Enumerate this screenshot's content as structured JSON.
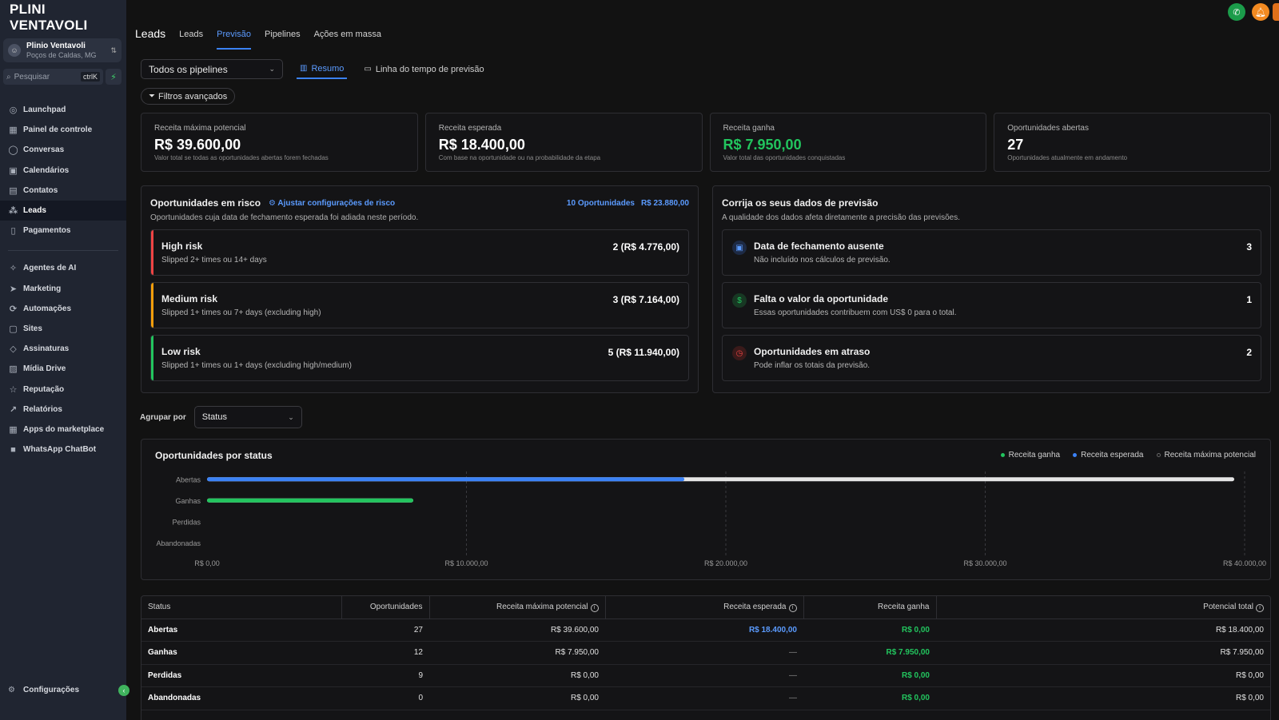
{
  "sidebar": {
    "logo": "PLINI VENTAVOLI",
    "account": {
      "name": "Plinio Ventavoli",
      "location": "Poços de Caldas, MG"
    },
    "search": {
      "placeholder": "Pesquisar",
      "shortcut": "ctrlK"
    },
    "items": [
      {
        "label": "Launchpad",
        "icon": "rocket-icon"
      },
      {
        "label": "Painel de controle",
        "icon": "grid-icon"
      },
      {
        "label": "Conversas",
        "icon": "chat-icon"
      },
      {
        "label": "Calendários",
        "icon": "calendar-icon"
      },
      {
        "label": "Contatos",
        "icon": "contacts-icon"
      },
      {
        "label": "Leads",
        "icon": "leads-icon",
        "active": true
      },
      {
        "label": "Pagamentos",
        "icon": "payments-icon"
      }
    ],
    "items2": [
      {
        "label": "Agentes de AI",
        "icon": "sparkle-icon"
      },
      {
        "label": "Marketing",
        "icon": "send-icon"
      },
      {
        "label": "Automações",
        "icon": "automation-icon"
      },
      {
        "label": "Sites",
        "icon": "sites-icon"
      },
      {
        "label": "Assinaturas",
        "icon": "badge-icon"
      },
      {
        "label": "Mídia Drive",
        "icon": "image-icon"
      },
      {
        "label": "Reputação",
        "icon": "star-icon"
      },
      {
        "label": "Relatórios",
        "icon": "trend-icon"
      },
      {
        "label": "Apps do marketplace",
        "icon": "apps-icon"
      },
      {
        "label": "WhatsApp ChatBot",
        "icon": "whatsapp-icon"
      }
    ],
    "settings": "Configurações"
  },
  "header": {
    "title": "Leads",
    "tabs": [
      {
        "label": "Leads"
      },
      {
        "label": "Previsão",
        "active": true
      },
      {
        "label": "Pipelines"
      },
      {
        "label": "Ações em massa"
      }
    ]
  },
  "toolbar": {
    "pipeline_select": "Todos os pipelines",
    "view_tabs": [
      {
        "label": "Resumo",
        "active": true
      },
      {
        "label": "Linha do tempo de previsão"
      }
    ],
    "filters": "Filtros avançados"
  },
  "kpis": [
    {
      "label": "Receita máxima potencial",
      "value": "R$ 39.600,00",
      "desc": "Valor total se todas as oportunidades abertas forem fechadas"
    },
    {
      "label": "Receita esperada",
      "value": "R$ 18.400,00",
      "desc": "Com base na oportunidade ou na probabilidade da etapa"
    },
    {
      "label": "Receita ganha",
      "value": "R$ 7.950,00",
      "desc": "Valor total das oportunidades conquistadas"
    },
    {
      "label": "Oportunidades abertas",
      "value": "27",
      "desc": "Oportunidades atualmente em andamento"
    }
  ],
  "risk": {
    "title": "Oportunidades em risco",
    "link": "Ajustar configurações de risco",
    "count": "10 Oportunidades",
    "total": "R$ 23.880,00",
    "subtitle": "Oportunidades cuja data de fechamento esperada foi adiada neste período.",
    "rows": [
      {
        "title": "High risk",
        "desc": "Slipped 2+ times ou 14+ days",
        "value": "2 (R$ 4.776,00)",
        "color": "#ef4444"
      },
      {
        "title": "Medium risk",
        "desc": "Slipped 1+ times ou 7+ days (excluding high)",
        "value": "3 (R$ 7.164,00)",
        "color": "#f59e0b"
      },
      {
        "title": "Low risk",
        "desc": "Slipped 1+ times ou 1+ days (excluding high/medium)",
        "value": "5 (R$ 11.940,00)",
        "color": "#22c55e"
      }
    ]
  },
  "fix": {
    "title": "Corrija os seus dados de previsão",
    "subtitle": "A qualidade dos dados afeta diretamente a precisão das previsões.",
    "rows": [
      {
        "title": "Data de fechamento ausente",
        "desc": "Não incluído nos cálculos de previsão.",
        "value": "3",
        "icon": "calendar-icon"
      },
      {
        "title": "Falta o valor da oportunidade",
        "desc": "Essas oportunidades contribuem com US$ 0 para o total.",
        "value": "1",
        "icon": "dollar-icon"
      },
      {
        "title": "Oportunidades em atraso",
        "desc": "Pode inflar os totais da previsão.",
        "value": "2",
        "icon": "clock-icon"
      }
    ]
  },
  "groupby": {
    "label": "Agrupar por",
    "value": "Status"
  },
  "chart_data": {
    "type": "bar",
    "orientation": "horizontal",
    "title": "Oportunidades por status",
    "categories": [
      "Abertas",
      "Ganhas",
      "Perdidas",
      "Abandonadas"
    ],
    "series": [
      {
        "name": "Receita ganha",
        "color": "#22c55e",
        "values": [
          0,
          7950,
          0,
          0
        ]
      },
      {
        "name": "Receita esperada",
        "color": "#3b82f6",
        "values": [
          18400,
          0,
          0,
          0
        ]
      },
      {
        "name": "Receita máxima potencial",
        "color": "#e5e5e5",
        "values": [
          39600,
          7950,
          0,
          0
        ]
      }
    ],
    "xlim": [
      0,
      40000
    ],
    "xticks": [
      "R$ 0,00",
      "R$ 10.000,00",
      "R$ 20.000,00",
      "R$ 30.000,00",
      "R$ 40.000,00"
    ],
    "legend": "top-right",
    "grid": true
  },
  "table": {
    "headers": [
      "Status",
      "Oportunidades",
      "Receita máxima potencial",
      "Receita esperada",
      "Receita ganha",
      "Potencial total"
    ],
    "rows": [
      [
        "Abertas",
        "27",
        "R$ 39.600,00",
        "R$ 18.400,00",
        "R$ 0,00",
        "R$ 18.400,00"
      ],
      [
        "Ganhas",
        "12",
        "R$ 7.950,00",
        "—",
        "R$ 7.950,00",
        "R$ 7.950,00"
      ],
      [
        "Perdidas",
        "9",
        "R$ 0,00",
        "—",
        "R$ 0,00",
        "R$ 0,00"
      ],
      [
        "Abandonadas",
        "0",
        "R$ 0,00",
        "—",
        "R$ 0,00",
        "R$ 0,00"
      ]
    ]
  }
}
